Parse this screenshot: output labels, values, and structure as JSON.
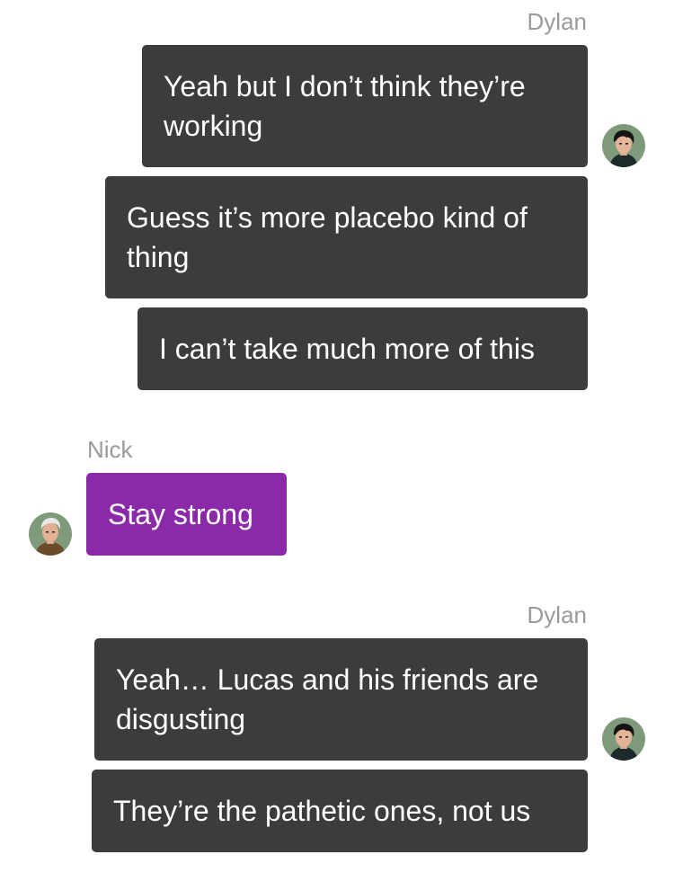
{
  "groups": [
    {
      "sender": "Dylan",
      "avatar_icon": "dylan-avatar",
      "messages": [
        "Yeah but I don’t think they’re working",
        "Guess it’s more placebo kind of thing",
        "I can’t take much more of this"
      ]
    },
    {
      "sender": "Nick",
      "avatar_icon": "nick-avatar",
      "messages": [
        "Stay strong"
      ]
    },
    {
      "sender": "Dylan",
      "avatar_icon": "dylan-avatar",
      "messages": [
        "Yeah… Lucas and his friends are disgusting",
        "They’re the pathetic ones, not us"
      ]
    }
  ],
  "colors": {
    "outgoing_bubble": "#3c3c3c",
    "incoming_bubble": "#8a2aa8",
    "sender_name": "#9a9a9a"
  }
}
